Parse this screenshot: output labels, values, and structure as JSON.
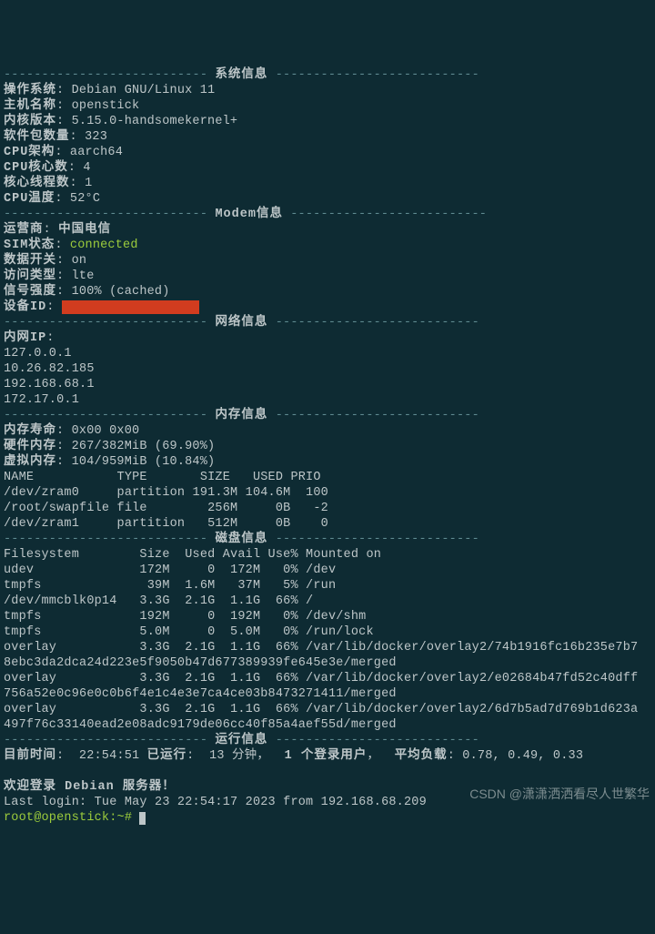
{
  "sections": {
    "system": "系统信息",
    "modem": "Modem信息",
    "network": "网络信息",
    "memory": "内存信息",
    "disk": "磁盘信息",
    "runtime": "运行信息"
  },
  "sys": {
    "os_label": "操作系统",
    "os": "Debian GNU/Linux 11",
    "host_label": "主机名称",
    "host": "openstick",
    "kernel_label": "内核版本",
    "kernel": "5.15.0-handsomekernel+",
    "pkg_label": "软件包数量",
    "pkg": "323",
    "arch_label": "CPU架构",
    "arch": "aarch64",
    "cores_label": "CPU核心数",
    "cores": "4",
    "threads_label": "核心线程数",
    "threads": "1",
    "temp_label": "CPU温度",
    "temp": "52°C"
  },
  "modem": {
    "carrier_label": "运营商",
    "carrier": "中国电信",
    "sim_label": "SIM状态",
    "sim": "connected",
    "data_label": "数据开关",
    "data": "on",
    "apn_label": "访问类型",
    "apn": "lte",
    "signal_label": "信号强度",
    "signal": "100% (cached)",
    "devid_label": "设备ID",
    "devid": "                  "
  },
  "net": {
    "lan_label": "内网IP",
    "ips": [
      "127.0.0.1",
      "10.26.82.185",
      "192.168.68.1",
      "172.17.0.1"
    ]
  },
  "mem": {
    "life_label": "内存寿命",
    "life": "0x00 0x00",
    "hw_label": "硬件内存",
    "hw": "267/382MiB (69.90%)",
    "vm_label": "虚拟内存",
    "vm": "104/959MiB (10.84%)",
    "header": "NAME           TYPE       SIZE   USED PRIO",
    "rows": [
      "/dev/zram0     partition 191.3M 104.6M  100",
      "/root/swapfile file        256M     0B   -2",
      "/dev/zram1     partition   512M     0B    0"
    ]
  },
  "disk": {
    "header": "Filesystem        Size  Used Avail Use% Mounted on",
    "rows": [
      "udev              172M     0  172M   0% /dev",
      "tmpfs              39M  1.6M   37M   5% /run",
      "/dev/mmcblk0p14   3.3G  2.1G  1.1G  66% /",
      "tmpfs             192M     0  192M   0% /dev/shm",
      "tmpfs             5.0M     0  5.0M   0% /run/lock",
      "overlay           3.3G  2.1G  1.1G  66% /var/lib/docker/overlay2/74b1916fc16b235e7b7",
      "8ebc3da2dca24d223e5f9050b47d677389939fe645e3e/merged",
      "overlay           3.3G  2.1G  1.1G  66% /var/lib/docker/overlay2/e02684b47fd52c40dff",
      "756a52e0c96e0c0b6f4e1c4e3e7ca4ce03b8473271411/merged",
      "overlay           3.3G  2.1G  1.1G  66% /var/lib/docker/overlay2/6d7b5ad7d769b1d623a",
      "497f76c33140ead2e08adc9179de06cc40f85a4aef55d/merged"
    ]
  },
  "runtime": {
    "now_label": "目前时间",
    "now": "22:54:51",
    "up_label": "已运行",
    "up": "13 分钟",
    "users": "1 个登录用户",
    "load_label": "平均负载",
    "load": "0.78, 0.49, 0.33"
  },
  "footer": {
    "welcome": "欢迎登录 Debian 服务器！",
    "lastlogin": "Last login: Tue May 23 22:54:17 2023 from 192.168.68.209",
    "prompt": "root@openstick:~# "
  },
  "watermark": "CSDN @潇潇洒洒看尽人世繁华"
}
